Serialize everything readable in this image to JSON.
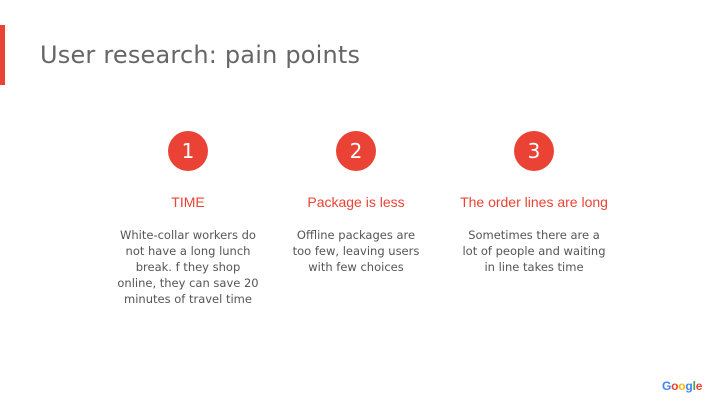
{
  "slide": {
    "title": "User research: pain points",
    "accent_color": "#ea4335",
    "text_color": "#555555"
  },
  "pain_points": [
    {
      "number": "1",
      "heading": "TIME",
      "description": "White-collar workers do not have a long lunch break.  f they shop online, they can save 20 minutes of travel time"
    },
    {
      "number": "2",
      "heading": "Package is less",
      "description": "Offline packages are too few, leaving users with few choices"
    },
    {
      "number": "3",
      "heading": "The order lines are long",
      "description": "Sometimes there are a lot of people and waiting in line takes time"
    }
  ],
  "logo": {
    "text": "Google",
    "letter_colors": [
      "#4285f4",
      "#ea4335",
      "#fbbc05",
      "#4285f4",
      "#34a853",
      "#ea4335"
    ]
  }
}
